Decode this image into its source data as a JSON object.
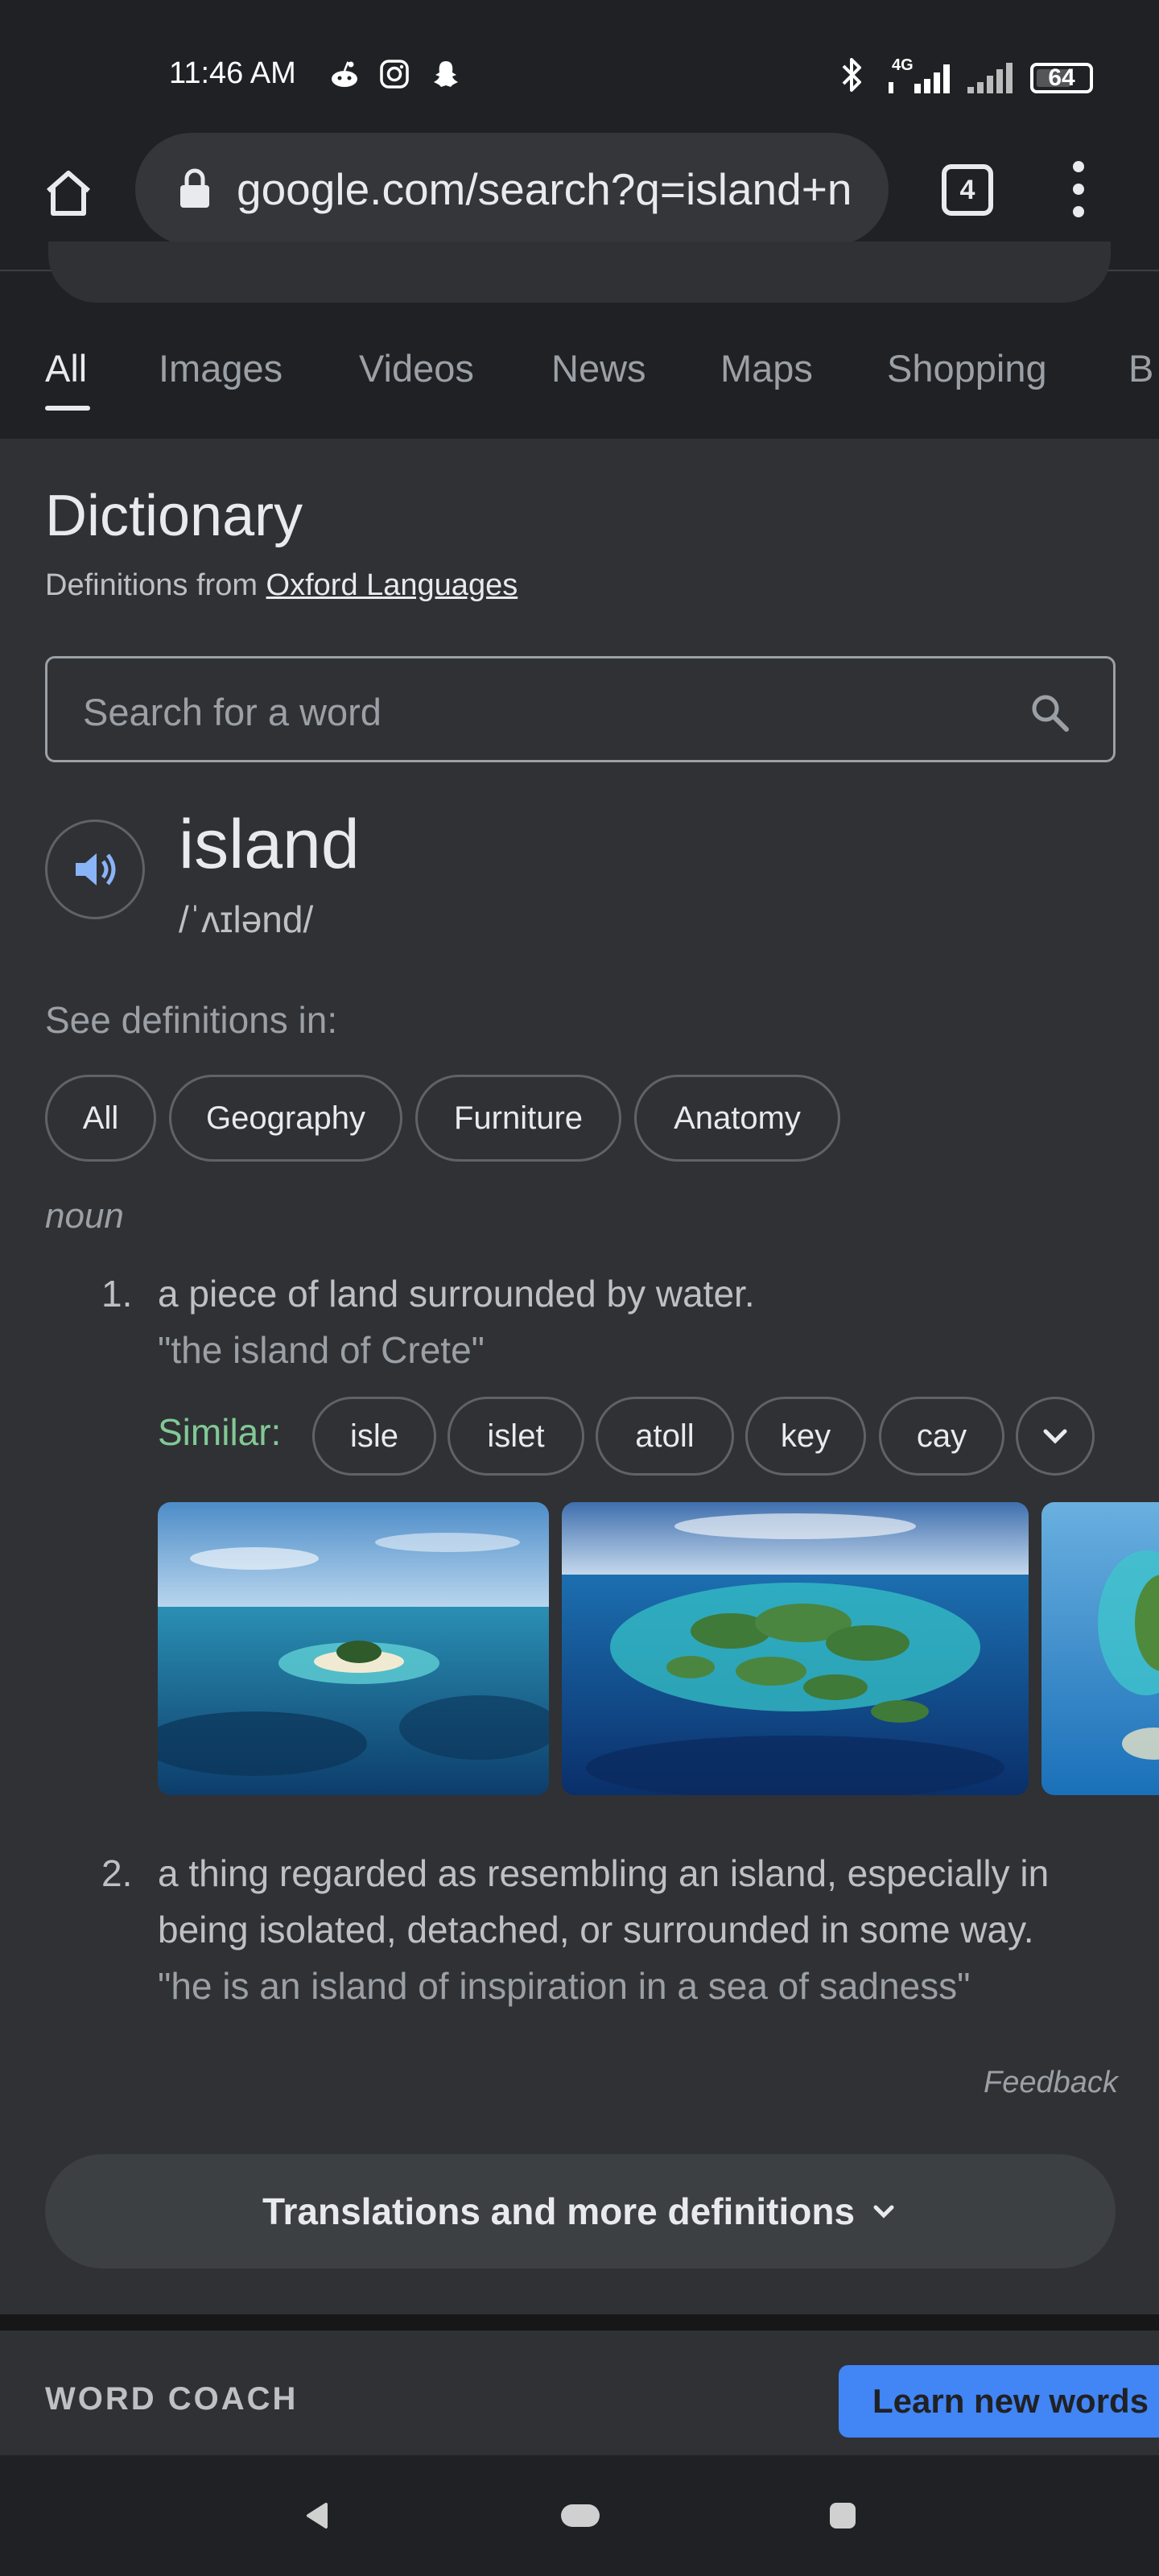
{
  "status_bar": {
    "time": "11:46 AM",
    "network": "4G",
    "battery": "64"
  },
  "toolbar": {
    "url": "google.com/search?q=island+n",
    "tab_count": "4"
  },
  "search_tabs": [
    "All",
    "Images",
    "Videos",
    "News",
    "Maps",
    "Shopping",
    "B"
  ],
  "dictionary": {
    "title": "Dictionary",
    "source_prefix": "Definitions from",
    "source_link": "Oxford Languages",
    "search_placeholder": "Search for a word",
    "word": "island",
    "pronunciation": "/ˈʌɪlənd/",
    "see_definitions_label": "See definitions in:",
    "categories": [
      "All",
      "Geography",
      "Furniture",
      "Anatomy"
    ],
    "part_of_speech": "noun",
    "definitions": [
      {
        "number": "1.",
        "text": "a piece of land surrounded by water.",
        "example": "\"the island of Crete\"",
        "similar_label": "Similar:",
        "similar": [
          "isle",
          "islet",
          "atoll",
          "key",
          "cay"
        ]
      },
      {
        "number": "2.",
        "text_line1": "a thing regarded as resembling an island, especially in",
        "text_line2": "being isolated, detached, or surrounded in some way.",
        "example": "\"he is an island of inspiration in a sea of sadness\""
      }
    ],
    "feedback": "Feedback",
    "more_button": "Translations and more definitions"
  },
  "word_coach": {
    "title": "WORD COACH",
    "button": "Learn new words"
  },
  "colors": {
    "background": "#202124",
    "card": "#303134",
    "accent_green": "#81c995",
    "accent_blue": "#4285f4"
  }
}
